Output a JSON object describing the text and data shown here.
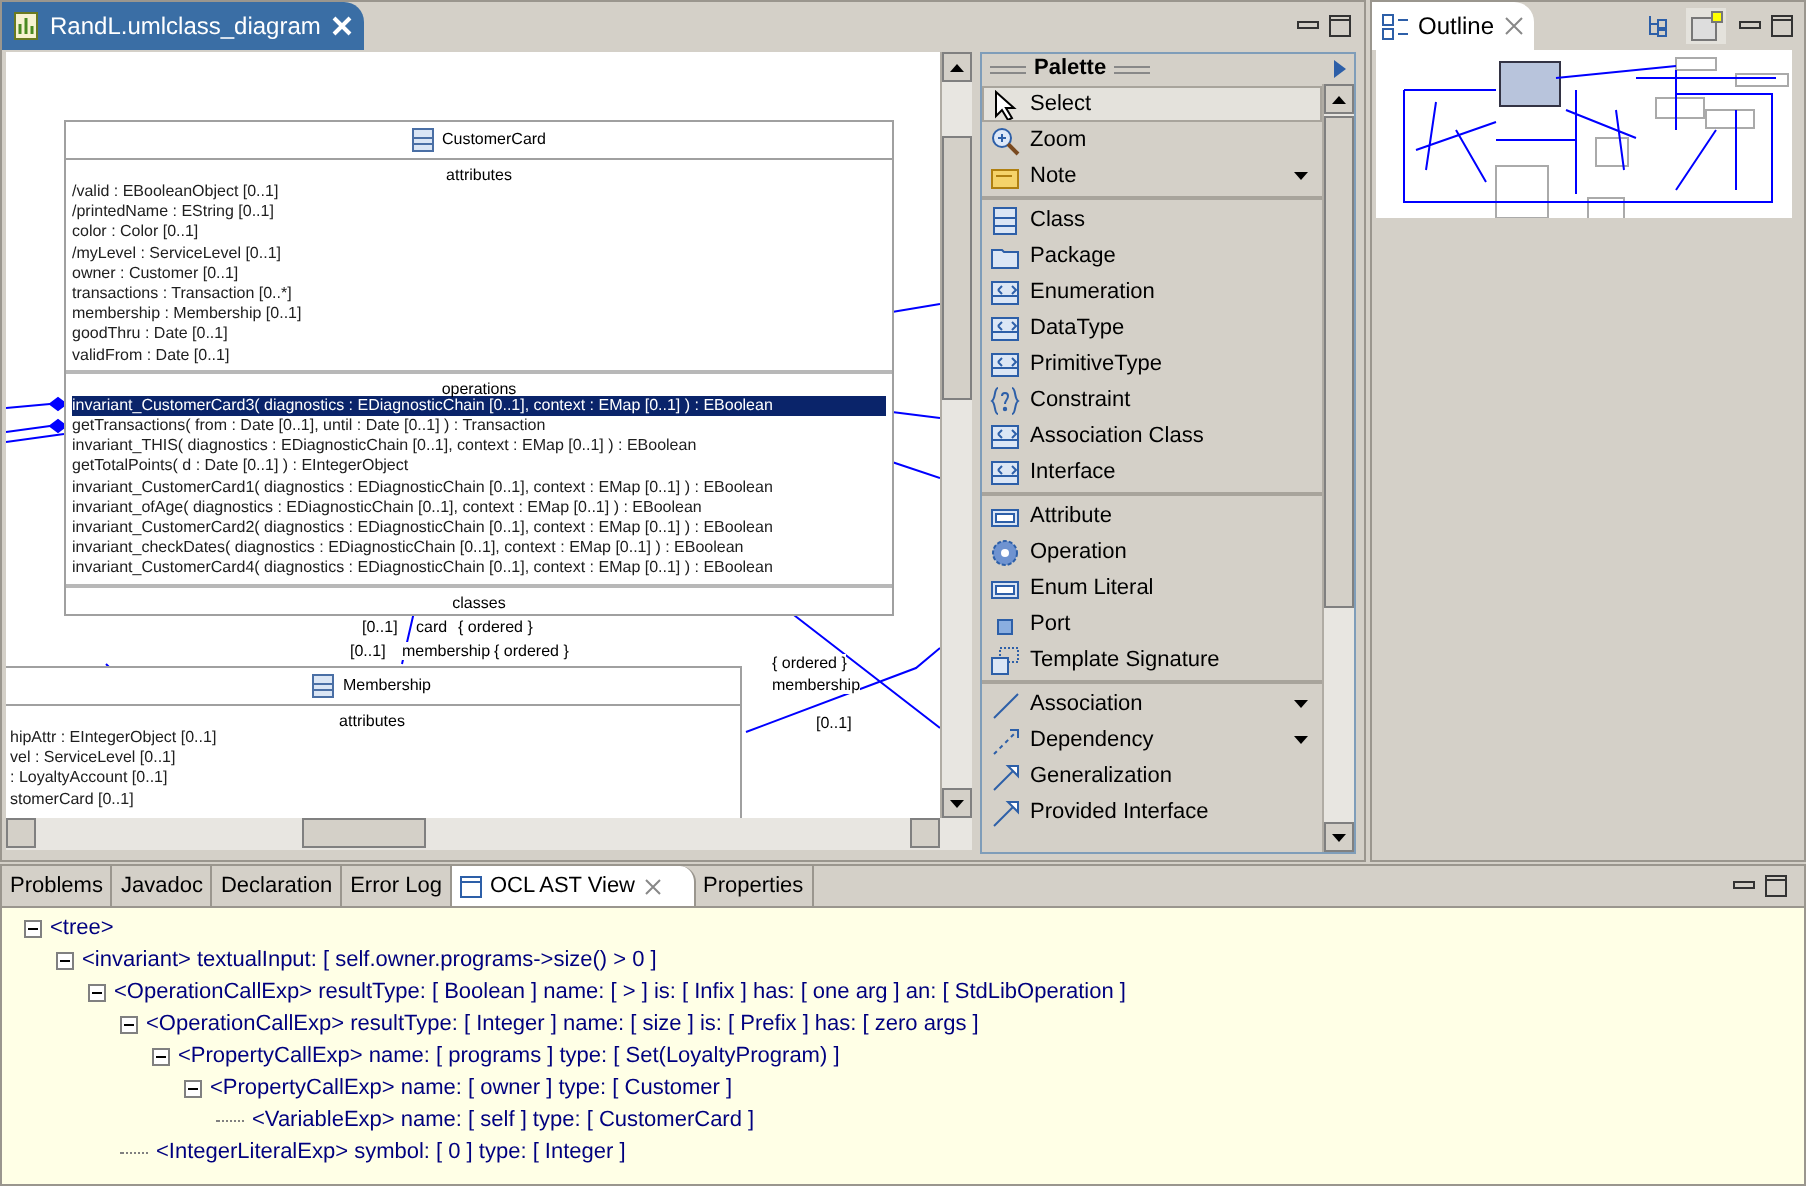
{
  "editor": {
    "tab_title": "RandL.umlclass_diagram",
    "classes": [
      {
        "name": "CustomerCard",
        "sections": [
          {
            "title": "attributes",
            "items": [
              {
                "text": "/valid : EBooleanObject [0..1]",
                "selected": false
              },
              {
                "text": "/printedName : EString [0..1]",
                "selected": false
              },
              {
                "text": "color : Color [0..1]",
                "selected": false
              },
              {
                "text": "/myLevel : ServiceLevel [0..1]",
                "selected": false
              },
              {
                "text": "owner : Customer [0..1]",
                "selected": false
              },
              {
                "text": "transactions : Transaction [0..*]",
                "selected": false
              },
              {
                "text": "membership : Membership [0..1]",
                "selected": false
              },
              {
                "text": "goodThru : Date [0..1]",
                "selected": false
              },
              {
                "text": "validFrom : Date [0..1]",
                "selected": false
              }
            ]
          },
          {
            "title": "operations",
            "items": [
              {
                "text": "invariant_CustomerCard3( diagnostics : EDiagnosticChain [0..1], context : EMap [0..1] ) : EBoolean",
                "selected": true
              },
              {
                "text": "getTransactions( from : Date [0..1], until : Date [0..1] ) : Transaction",
                "selected": false
              },
              {
                "text": "invariant_THIS( diagnostics : EDiagnosticChain [0..1], context : EMap [0..1] ) : EBoolean",
                "selected": false
              },
              {
                "text": "getTotalPoints( d : Date [0..1] ) : EIntegerObject",
                "selected": false
              },
              {
                "text": "invariant_CustomerCard1( diagnostics : EDiagnosticChain [0..1], context : EMap [0..1] ) : EBoolean",
                "selected": false
              },
              {
                "text": "invariant_ofAge( diagnostics : EDiagnosticChain [0..1], context : EMap [0..1] ) : EBoolean",
                "selected": false
              },
              {
                "text": "invariant_CustomerCard2( diagnostics : EDiagnosticChain [0..1], context : EMap [0..1] ) : EBoolean",
                "selected": false
              },
              {
                "text": "invariant_checkDates( diagnostics : EDiagnosticChain [0..1], context : EMap [0..1] ) : EBoolean",
                "selected": false
              },
              {
                "text": "invariant_CustomerCard4( diagnostics : EDiagnosticChain [0..1], context : EMap [0..1] ) : EBoolean",
                "selected": false
              }
            ]
          },
          {
            "title": "classes"
          }
        ]
      },
      {
        "name": "Membership",
        "sections": [
          {
            "title": "attributes",
            "items": [
              {
                "text": "hipAttr : EIntegerObject [0..1]",
                "selected": false
              },
              {
                "text": "vel : ServiceLevel [0..1]",
                "selected": false
              },
              {
                "text": ": LoyaltyAccount [0..1]",
                "selected": false
              },
              {
                "text": "stomerCard [0..1]",
                "selected": false
              }
            ]
          }
        ]
      }
    ],
    "edge_labels": [
      "[0..1]",
      "card",
      "{ ordered }",
      "[0..1]",
      "membership",
      "{ ordered }",
      "{ ordered }",
      "membership",
      "[0..1]"
    ]
  },
  "palette": {
    "title": "Palette",
    "groups": [
      [
        {
          "label": "Select",
          "selected": true,
          "menu": false
        },
        {
          "label": "Zoom",
          "selected": false,
          "menu": false
        },
        {
          "label": "Note",
          "selected": false,
          "menu": true
        }
      ],
      [
        {
          "label": "Class",
          "selected": false,
          "menu": false
        },
        {
          "label": "Package",
          "selected": false,
          "menu": false
        },
        {
          "label": "Enumeration",
          "selected": false,
          "menu": false
        },
        {
          "label": "DataType",
          "selected": false,
          "menu": false
        },
        {
          "label": "PrimitiveType",
          "selected": false,
          "menu": false
        },
        {
          "label": "Constraint",
          "selected": false,
          "menu": false
        },
        {
          "label": "Association Class",
          "selected": false,
          "menu": false
        },
        {
          "label": "Interface",
          "selected": false,
          "menu": false
        }
      ],
      [
        {
          "label": "Attribute",
          "selected": false,
          "menu": false
        },
        {
          "label": "Operation",
          "selected": false,
          "menu": false
        },
        {
          "label": "Enum Literal",
          "selected": false,
          "menu": false
        },
        {
          "label": "Port",
          "selected": false,
          "menu": false
        },
        {
          "label": "Template Signature",
          "selected": false,
          "menu": false
        }
      ],
      [
        {
          "label": "Association",
          "selected": false,
          "menu": true
        },
        {
          "label": "Dependency",
          "selected": false,
          "menu": true
        },
        {
          "label": "Generalization",
          "selected": false,
          "menu": false
        },
        {
          "label": "Provided Interface",
          "selected": false,
          "menu": false
        }
      ]
    ]
  },
  "outline": {
    "title": "Outline"
  },
  "bottom": {
    "tabs": [
      {
        "label": "Problems",
        "selected": false
      },
      {
        "label": "Javadoc",
        "selected": false
      },
      {
        "label": "Declaration",
        "selected": false
      },
      {
        "label": "Error Log",
        "selected": false
      },
      {
        "label": "OCL AST View",
        "selected": true
      },
      {
        "label": "Properties",
        "selected": false
      }
    ],
    "tree": {
      "text": "<tree>",
      "expanded": true,
      "children": [
        {
          "text": "<invariant>  textualInput: [ self.owner.programs->size() > 0 ]",
          "expanded": true,
          "children": [
            {
              "text": "<OperationCallExp>  resultType: [ Boolean ]  name: [ > ]  is: [ Infix ]  has: [ one arg ]  an: [ StdLibOperation ]",
              "expanded": true,
              "children": [
                {
                  "text": "<OperationCallExp>  resultType: [ Integer ]  name: [ size ]  is: [ Prefix ]  has: [ zero args ]",
                  "expanded": true,
                  "children": [
                    {
                      "text": "<PropertyCallExp>  name: [ programs ]  type: [ Set(LoyaltyProgram) ]",
                      "expanded": true,
                      "children": [
                        {
                          "text": "<PropertyCallExp>  name: [ owner ]  type: [ Customer ]",
                          "expanded": true,
                          "children": [
                            {
                              "text": "<VariableExp>  name: [ self ]  type: [ CustomerCard ]"
                            }
                          ]
                        }
                      ]
                    }
                  ]
                },
                {
                  "text": "<IntegerLiteralExp>  symbol: [ 0 ]  type: [ Integer ]"
                }
              ]
            }
          ]
        }
      ]
    }
  }
}
